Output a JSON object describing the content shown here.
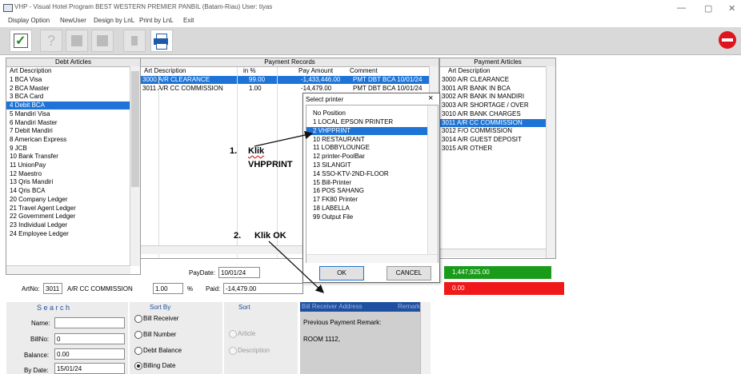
{
  "window": {
    "title": "VHP - Visual Hotel Program     BEST WESTERN PREMIER PANBIL (Batam-Riau) User: tiyas"
  },
  "menu": [
    "Display Option",
    "NewUser",
    "Design by LnL",
    "Print by LnL",
    "Exit"
  ],
  "debt_articles": {
    "title": "Debt Articles",
    "col": "Art Description",
    "rows": [
      "1 BCA Visa",
      "2 BCA Master",
      "3 BCA Card",
      "4 Debit BCA",
      "5 Mandiri Visa",
      "6 Mandiri Master",
      "7 Debit Mandiri",
      "8 American Express",
      "9 JCB",
      "10 Bank Transfer",
      "11 UnionPay",
      "12 Maestro",
      "13 Qris Mandiri",
      "14 Qris BCA",
      "20 Company Ledger",
      "21 Travel Agent Ledger",
      "22 Government Ledger",
      "23 Individual Ledger",
      "24 Employee Ledger"
    ]
  },
  "payment_records": {
    "title": "Payment Records",
    "cols": [
      "Art Description",
      "in %",
      "Pay Amount",
      "Comment"
    ],
    "rows": [
      [
        "3000 A/R CLEARANCE",
        "99.00",
        "-1,433,446.00",
        "PMT DBT BCA 10/01/24"
      ],
      [
        "3011 A/R CC COMMISSION",
        "1.00",
        "-14,479.00",
        "PMT DBT BCA 10/01/24"
      ]
    ]
  },
  "payment_articles": {
    "title": "Payment Articles",
    "col": "Art Description",
    "rows": [
      "3000 A/R CLEARANCE",
      "3001 A/R BANK IN BCA",
      "3002 A/R BANK IN MANDIRI",
      "3003 A/R SHORTAGE / OVER",
      "3010 A/R BANK CHARGES",
      "3011 A/R CC COMMISSION",
      "3012 F/O COMMISSION",
      "3014 A/R GUEST DEPOSIT",
      "3015 A/R OTHER"
    ]
  },
  "pay_date": {
    "label": "PayDate:",
    "value": "10/01/24"
  },
  "art_no": {
    "label": "ArtNo:",
    "value": "3011",
    "desc": "A/R CC COMMISSION"
  },
  "percent": {
    "value": "1.00",
    "sign": "%"
  },
  "paid": {
    "label": "Paid:",
    "value": "-14,479.00"
  },
  "total_green": "1,447,925.00",
  "total_red": "0.00",
  "search": {
    "title": "S e a r c h",
    "name_label": "Name:",
    "name_value": "",
    "billno_label": "BillNo:",
    "billno_value": "0",
    "balance_label": "Balance:",
    "balance_value": "0.00",
    "bydate_label": "By Date:",
    "bydate_value": "15/01/24"
  },
  "sort_by": {
    "title": "Sort By",
    "options": [
      "Bill Receiver",
      "Bill Number",
      "Debt Balance",
      "Billing Date"
    ]
  },
  "sort": {
    "title": "Sort",
    "options": [
      "Article",
      "Description"
    ]
  },
  "remark": {
    "header": "Bill Receiver Address",
    "header2": "Remark",
    "line1": "Previous Payment Remark:",
    "line2": "ROOM 1112,"
  },
  "dialog": {
    "title": "Select printer",
    "close": "×",
    "header": "No Position",
    "items": [
      "1 LOCAL EPSON PRINTER",
      "2 VHPPRINT",
      "10 RESTAURANT",
      "11 LOBBYLOUNGE",
      "12 printer-PoolBar",
      "13 SILANGIT",
      "14 SSO-KTV-2ND-FLOOR",
      "15 Bill-Printer",
      "16 POS SAHANG",
      "17 FK80 Printer",
      "18 LABELLA",
      "99 Output File"
    ],
    "ok": "OK",
    "cancel": "CANCEL"
  },
  "annotations": {
    "step1a": "1.",
    "step1b": "Klik",
    "step1c": "VHPPRINT",
    "step2a": "2.",
    "step2b": "Klik OK"
  },
  "colors": {
    "selection": "#1e74d6",
    "green": "#1a9b1a",
    "red": "#f01818"
  }
}
